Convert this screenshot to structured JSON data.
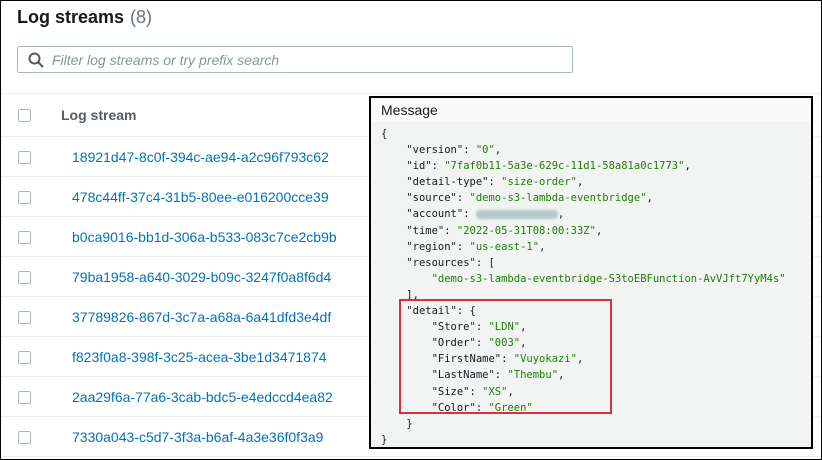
{
  "header": {
    "title": "Log streams",
    "count": "(8)"
  },
  "search": {
    "placeholder": "Filter log streams or try prefix search",
    "value": ""
  },
  "table": {
    "column_header": "Log stream",
    "rows": [
      "18921d47-8c0f-394c-ae94-a2c96f793c62",
      "478c44ff-37c4-31b5-80ee-e016200cce39",
      "b0ca9016-bb1d-306a-b533-083c7ce2cb9b",
      "79ba1958-a640-3029-b09c-3247f0a8f6d4",
      "37789826-867d-3c7a-a68a-6a41dfd3e4df",
      "f823f0a8-398f-3c25-acea-3be1d3471874",
      "2aa29f6a-77a6-3cab-bdc5-e4edccd4ea82",
      "7330a043-c5d7-3f3a-b6af-4a3e36f0f3a9"
    ]
  },
  "message": {
    "title": "Message",
    "open_brace": "{",
    "close_brace": "}",
    "version": {
      "key": "\"version\": ",
      "value": "\"0\"",
      "tail": ","
    },
    "id": {
      "key": "\"id\": ",
      "value": "\"7faf0b11-5a3e-629c-11d1-58a81a0c1773\"",
      "tail": ","
    },
    "detail_type": {
      "key": "\"detail-type\": ",
      "value": "\"size-order\"",
      "tail": ","
    },
    "source": {
      "key": "\"source\": ",
      "value": "\"demo-s3-lambda-eventbridge\"",
      "tail": ","
    },
    "account": {
      "key": "\"account\": ",
      "tail": ","
    },
    "time": {
      "key": "\"time\": ",
      "value": "\"2022-05-31T08:00:33Z\"",
      "tail": ","
    },
    "region": {
      "key": "\"region\": ",
      "value": "\"us-east-1\"",
      "tail": ","
    },
    "resources": {
      "key": "\"resources\": [",
      "item": "\"demo-s3-lambda-eventbridge-S3toEBFunction-AvVJft7YyM4s\"",
      "close": "],"
    },
    "detail": {
      "key": "\"detail\": {",
      "store": {
        "key": "\"Store\": ",
        "value": "\"LDN\"",
        "tail": ","
      },
      "order": {
        "key": "\"Order\": ",
        "value": "\"003\"",
        "tail": ","
      },
      "first_name": {
        "key": "\"FirstName\": ",
        "value": "\"Vuyokazi\"",
        "tail": ","
      },
      "last_name": {
        "key": "\"LastName\": ",
        "value": "\"Thembu\"",
        "tail": ","
      },
      "size": {
        "key": "\"Size\": ",
        "value": "\"XS\"",
        "tail": ","
      },
      "color": {
        "key": "\"Color\": ",
        "value": "\"Green\""
      },
      "close": "}"
    }
  },
  "colors": {
    "link": "#0073bb",
    "json_string": "#1d8102",
    "highlight_border": "#e02d3c"
  }
}
